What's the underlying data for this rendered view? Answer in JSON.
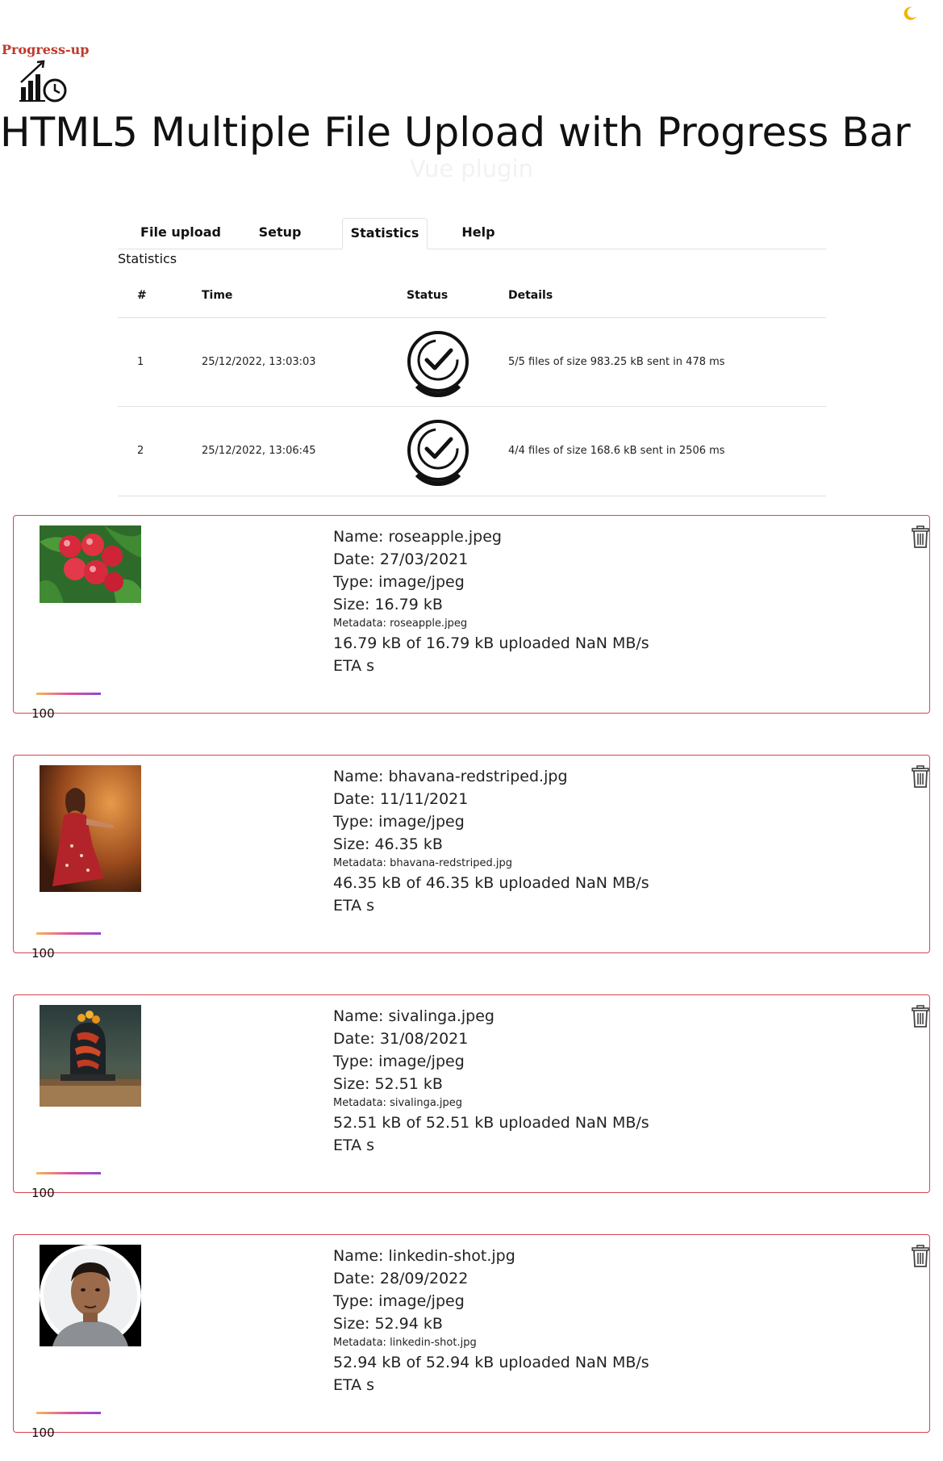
{
  "header": {
    "logo_text": "Progress-up",
    "title": "HTML5 Multiple File Upload with Progress Bar",
    "subtitle": "Vue plugin"
  },
  "tabs": [
    {
      "label": "File upload",
      "active": false
    },
    {
      "label": "Setup",
      "active": false
    },
    {
      "label": "Statistics",
      "active": true
    },
    {
      "label": "Help",
      "active": false
    }
  ],
  "statistics": {
    "label": "Statistics",
    "columns": [
      "#",
      "Time",
      "Status",
      "Details"
    ],
    "rows": [
      {
        "num": "1",
        "time": "25/12/2022, 13:03:03",
        "status_icon": "check-circle-icon",
        "details": "5/5 files of size 983.25 kB sent in 478 ms"
      },
      {
        "num": "2",
        "time": "25/12/2022, 13:06:45",
        "status_icon": "check-circle-icon",
        "details": "4/4 files of size 168.6 kB sent in 2506 ms"
      }
    ]
  },
  "files": [
    {
      "name": "Name: roseapple.jpeg",
      "date": "Date: 27/03/2021",
      "type": "Type: image/jpeg",
      "size": "Size: 16.79 kB",
      "metadata": "Metadata: roseapple.jpeg",
      "uploaded": "16.79 kB of 16.79 kB uploaded NaN MB/s ETA s",
      "progress": "100",
      "progress_fraction": 1.0
    },
    {
      "name": "Name: bhavana-redstriped.jpg",
      "date": "Date: 11/11/2021",
      "type": "Type: image/jpeg",
      "size": "Size: 46.35 kB",
      "metadata": "Metadata: bhavana-redstriped.jpg",
      "uploaded": "46.35 kB of 46.35 kB uploaded NaN MB/s ETA s",
      "progress": "100",
      "progress_fraction": 1.0
    },
    {
      "name": "Name: sivalinga.jpeg",
      "date": "Date: 31/08/2021",
      "type": "Type: image/jpeg",
      "size": "Size: 52.51 kB",
      "metadata": "Metadata: sivalinga.jpeg",
      "uploaded": "52.51 kB of 52.51 kB uploaded NaN MB/s ETA s",
      "progress": "100",
      "progress_fraction": 1.0
    },
    {
      "name": "Name: linkedin-shot.jpg",
      "date": "Date: 28/09/2022",
      "type": "Type: image/jpeg",
      "size": "Size: 52.94 kB",
      "metadata": "Metadata: linkedin-shot.jpg",
      "uploaded": "52.94 kB of 52.94 kB uploaded NaN MB/s ETA s",
      "progress": "100",
      "progress_fraction": 1.0
    }
  ],
  "icons": {
    "theme": "moon-icon",
    "delete": "trash-icon",
    "logo": "chart-clock-icon"
  },
  "colors": {
    "card_border": "#d64550",
    "logo_text": "#c0392b",
    "moon": "#f0b400"
  }
}
